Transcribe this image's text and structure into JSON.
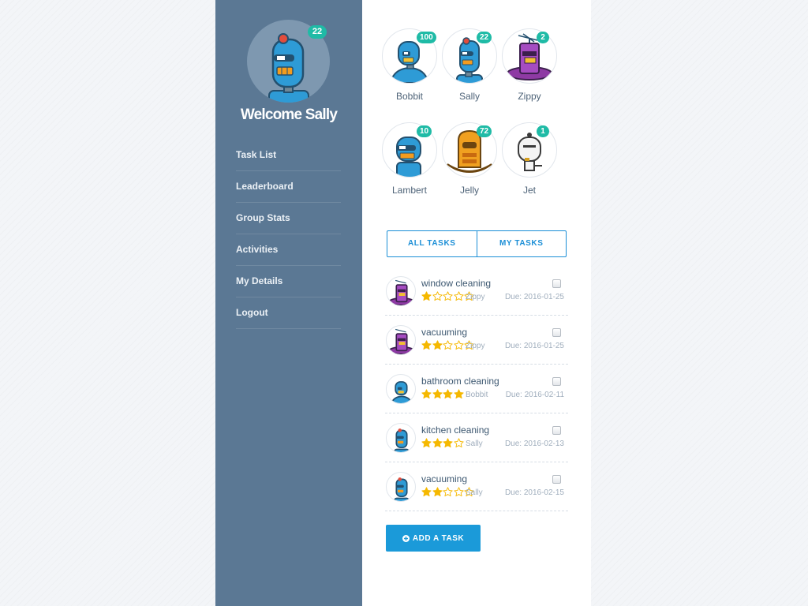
{
  "profile": {
    "badge": "22",
    "welcome": "Welcome Sally",
    "icon": "robot-sally-icon"
  },
  "nav": [
    {
      "label": "Task List"
    },
    {
      "label": "Leaderboard"
    },
    {
      "label": "Group Stats"
    },
    {
      "label": "Activities"
    },
    {
      "label": "My Details"
    },
    {
      "label": "Logout"
    }
  ],
  "robots": [
    {
      "name": "Bobbit",
      "count": "100",
      "icon": "robot-bobbit-icon"
    },
    {
      "name": "Sally",
      "count": "22",
      "icon": "robot-sally-icon"
    },
    {
      "name": "Zippy",
      "count": "2",
      "icon": "robot-zippy-icon"
    },
    {
      "name": "Lambert",
      "count": "10",
      "icon": "robot-lambert-icon"
    },
    {
      "name": "Jelly",
      "count": "72",
      "icon": "robot-jelly-icon"
    },
    {
      "name": "Jet",
      "count": "1",
      "icon": "robot-jet-icon"
    }
  ],
  "tabs": {
    "all": "ALL TASKS",
    "mine": "MY TASKS"
  },
  "tasks": [
    {
      "title": "window cleaning",
      "rating": 1,
      "max_rating": 5,
      "owner": "Zippy",
      "due": "Due: 2016-01-25"
    },
    {
      "title": "vacuuming",
      "rating": 2,
      "max_rating": 5,
      "owner": "Zippy",
      "due": "Due: 2016-01-25"
    },
    {
      "title": "bathroom cleaning",
      "rating": 4,
      "max_rating": 4,
      "owner": "Bobbit",
      "due": "Due: 2016-02-11"
    },
    {
      "title": "kitchen cleaning",
      "rating": 3,
      "max_rating": 4,
      "owner": "Sally",
      "due": "Due: 2016-02-13"
    },
    {
      "title": "vacuuming",
      "rating": 2,
      "max_rating": 5,
      "owner": "Sally",
      "due": "Due: 2016-02-15"
    }
  ],
  "add_task": {
    "label": "ADD A TASK",
    "icon": "plus-circle-icon"
  },
  "colors": {
    "sidebar": "#5b7894",
    "accent": "#1b9ad9",
    "badge": "#1fbba6",
    "star": "#f5b800"
  }
}
